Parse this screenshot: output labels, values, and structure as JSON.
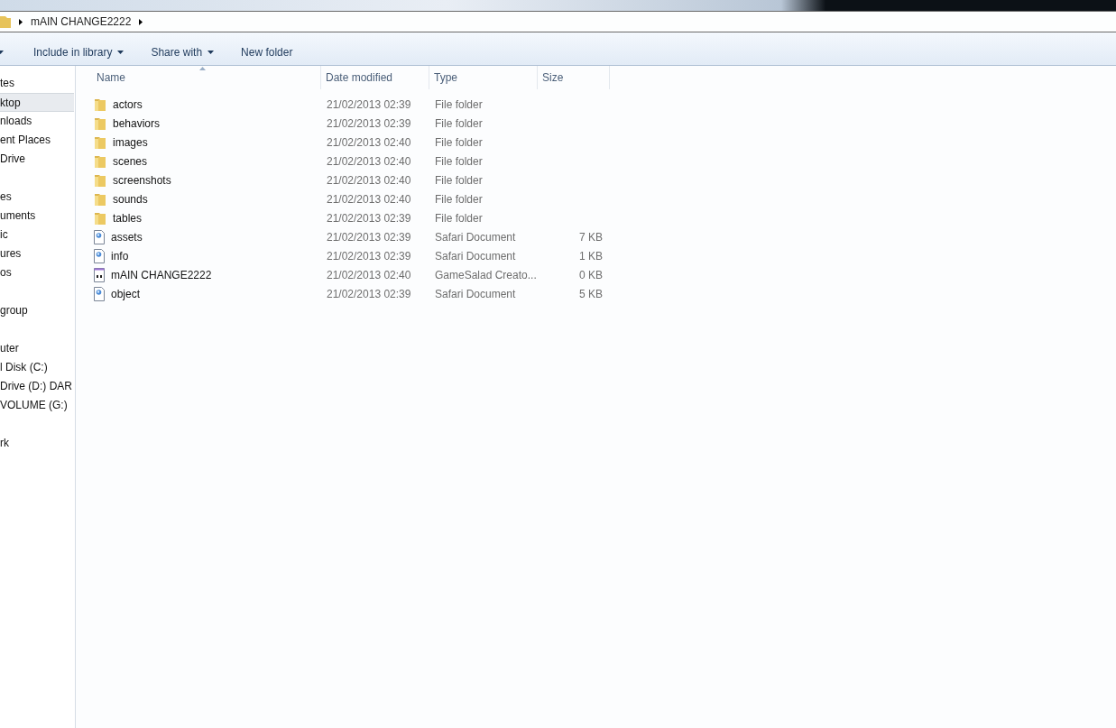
{
  "address_bar": {
    "path": "mAIN CHANGE2222"
  },
  "toolbar": {
    "buttons": [
      {
        "label": "Include in library",
        "dropdown": true
      },
      {
        "label": "Share with",
        "dropdown": true
      },
      {
        "label": "New folder",
        "dropdown": false
      }
    ]
  },
  "sidebar": {
    "groups": [
      {
        "items": [
          {
            "label": "tes",
            "selected": false
          },
          {
            "label": "ktop",
            "selected": true
          },
          {
            "label": "nloads",
            "selected": false
          },
          {
            "label": "ent Places",
            "selected": false
          },
          {
            "label": "Drive",
            "selected": false
          }
        ]
      },
      {
        "items": [
          {
            "label": "es",
            "selected": false
          },
          {
            "label": "uments",
            "selected": false
          },
          {
            "label": "ic",
            "selected": false
          },
          {
            "label": "ures",
            "selected": false
          },
          {
            "label": "os",
            "selected": false
          }
        ]
      },
      {
        "items": [
          {
            "label": "group",
            "selected": false
          }
        ]
      },
      {
        "items": [
          {
            "label": "uter",
            "selected": false
          },
          {
            "label": "l Disk (C:)",
            "selected": false
          },
          {
            "label": "Drive (D:) DAR",
            "selected": false
          },
          {
            "label": "VOLUME (G:)",
            "selected": false
          }
        ]
      },
      {
        "items": [
          {
            "label": "rk",
            "selected": false
          }
        ]
      }
    ]
  },
  "table": {
    "columns": [
      "Name",
      "Date modified",
      "Type",
      "Size"
    ],
    "rows": [
      {
        "kind": "folder",
        "name": "actors",
        "date": "21/02/2013 02:39",
        "type": "File folder"
      },
      {
        "kind": "folder",
        "name": "behaviors",
        "date": "21/02/2013 02:39",
        "type": "File folder"
      },
      {
        "kind": "folder",
        "name": "images",
        "date": "21/02/2013 02:40",
        "type": "File folder"
      },
      {
        "kind": "folder",
        "name": "scenes",
        "date": "21/02/2013 02:40",
        "type": "File folder"
      },
      {
        "kind": "folder",
        "name": "screenshots",
        "date": "21/02/2013 02:40",
        "type": "File folder"
      },
      {
        "kind": "folder",
        "name": "sounds",
        "date": "21/02/2013 02:40",
        "type": "File folder"
      },
      {
        "kind": "folder",
        "name": "tables",
        "date": "21/02/2013 02:39",
        "type": "File folder"
      },
      {
        "kind": "document",
        "name": "assets",
        "date": "21/02/2013 02:39",
        "type": "Safari Document",
        "size": "7 KB"
      },
      {
        "kind": "document",
        "name": "info",
        "date": "21/02/2013 02:39",
        "type": "Safari Document",
        "size": "1 KB"
      },
      {
        "kind": "project",
        "name": "mAIN CHANGE2222",
        "date": "21/02/2013 02:40",
        "type": "GameSalad Creato...",
        "size": "0 KB"
      },
      {
        "kind": "document",
        "name": "object",
        "date": "21/02/2013 02:39",
        "type": "Safari Document",
        "size": "5 KB"
      }
    ]
  }
}
